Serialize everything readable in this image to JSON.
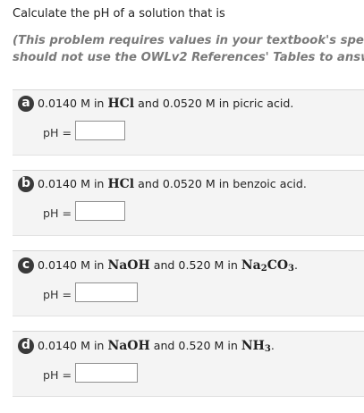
{
  "intro": "Calculate the pH of a solution that is",
  "note_line1": "(This problem requires values in your textbook's spec",
  "note_line2": "should not use the OWLv2 References' Tables to answ",
  "ph_label": "pH  =",
  "parts": [
    {
      "badge": "a",
      "text1": "0.0140 M in ",
      "chem1": "HCl",
      "text2": " and 0.0520 M in picric acid.",
      "input_value": ""
    },
    {
      "badge": "b",
      "text1": "0.0140 M in ",
      "chem1": "HCl",
      "text2": " and 0.0520 M in benzoic acid.",
      "input_value": ""
    },
    {
      "badge": "c",
      "text1": "0.0140 M in ",
      "chem1": "NaOH",
      "text2": " and 0.520 M in ",
      "chem2_base": "Na",
      "chem2_sub1": "2",
      "chem2_mid": "CO",
      "chem2_sub2": "3",
      "text3": ".",
      "input_value": ""
    },
    {
      "badge": "d",
      "text1": "0.0140 M in ",
      "chem1": "NaOH",
      "text2": " and 0.520 M in ",
      "chem2_base": "NH",
      "chem2_sub": "3",
      "text3": ".",
      "input_value": ""
    }
  ]
}
